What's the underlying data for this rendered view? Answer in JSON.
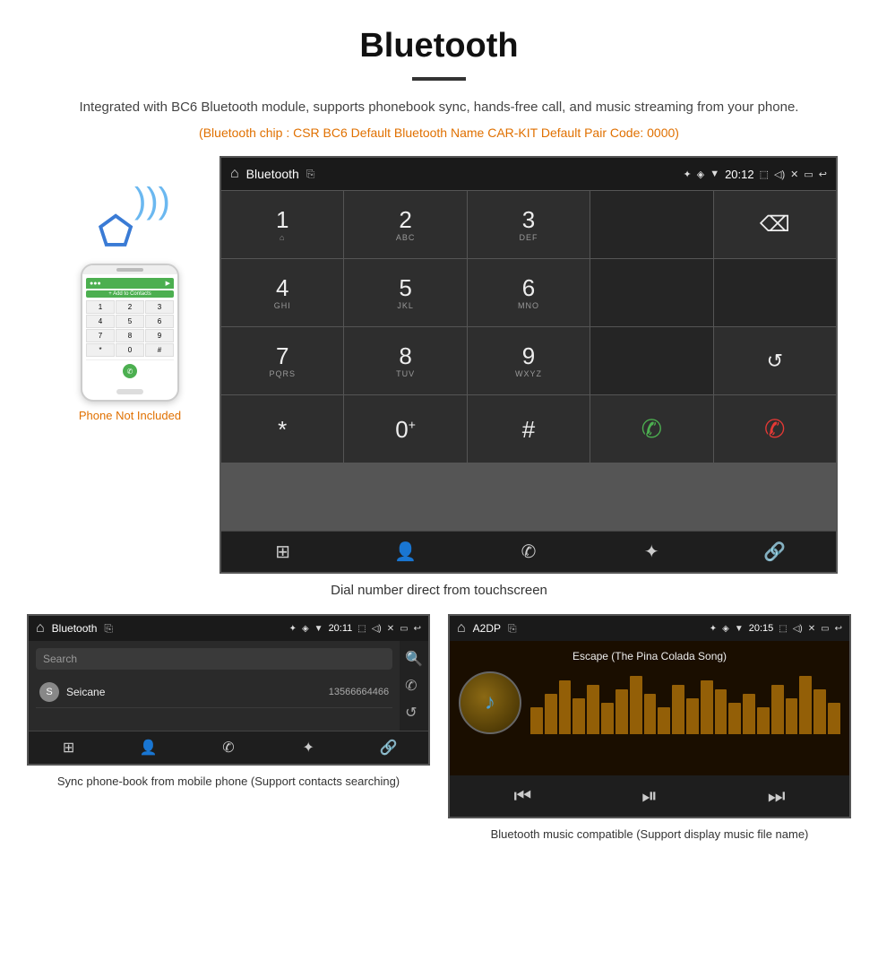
{
  "page": {
    "title": "Bluetooth",
    "subtitle": "Integrated with BC6 Bluetooth module, supports phonebook sync, hands-free call, and music streaming from your phone.",
    "orange_info": "(Bluetooth chip : CSR BC6    Default Bluetooth Name CAR-KIT    Default Pair Code: 0000)",
    "phone_not_included": "Phone Not Included",
    "caption_dial": "Dial number direct from touchscreen",
    "caption_phonebook": "Sync phone-book from mobile phone\n(Support contacts searching)",
    "caption_music": "Bluetooth music compatible\n(Support display music file name)"
  },
  "car_screen_main": {
    "status_bar": {
      "title": "Bluetooth",
      "time": "20:12"
    },
    "dialpad": [
      {
        "num": "1",
        "sub": "⌂",
        "type": "key"
      },
      {
        "num": "2",
        "sub": "ABC",
        "type": "key"
      },
      {
        "num": "3",
        "sub": "DEF",
        "type": "key"
      },
      {
        "num": "",
        "sub": "",
        "type": "empty"
      },
      {
        "num": "⌫",
        "sub": "",
        "type": "backspace"
      },
      {
        "num": "4",
        "sub": "GHI",
        "type": "key"
      },
      {
        "num": "5",
        "sub": "JKL",
        "type": "key"
      },
      {
        "num": "6",
        "sub": "MNO",
        "type": "key"
      },
      {
        "num": "",
        "sub": "",
        "type": "empty"
      },
      {
        "num": "",
        "sub": "",
        "type": "empty"
      },
      {
        "num": "7",
        "sub": "PQRS",
        "type": "key"
      },
      {
        "num": "8",
        "sub": "TUV",
        "type": "key"
      },
      {
        "num": "9",
        "sub": "WXYZ",
        "type": "key"
      },
      {
        "num": "",
        "sub": "",
        "type": "empty"
      },
      {
        "num": "↺",
        "sub": "",
        "type": "refresh"
      },
      {
        "num": "*",
        "sub": "",
        "type": "key"
      },
      {
        "num": "0",
        "sub": "+",
        "type": "key0"
      },
      {
        "num": "#",
        "sub": "",
        "type": "key"
      },
      {
        "num": "📞",
        "sub": "",
        "type": "call-green"
      },
      {
        "num": "📞",
        "sub": "",
        "type": "call-red"
      }
    ],
    "bottom_nav": [
      "⊞",
      "👤",
      "📞",
      "✦",
      "🔗"
    ]
  },
  "phonebook_screen": {
    "status_bar": {
      "title": "Bluetooth",
      "time": "20:11"
    },
    "search_placeholder": "Search",
    "contacts": [
      {
        "letter": "S",
        "name": "Seicane",
        "number": "13566664466"
      }
    ],
    "side_icons": [
      "🔍",
      "📞",
      "↺"
    ],
    "bottom_nav": [
      "⊞",
      "👤",
      "📞",
      "✦",
      "🔗"
    ]
  },
  "music_screen": {
    "status_bar": {
      "title": "A2DP",
      "time": "20:15"
    },
    "song_title": "Escape (The Pina Colada Song)",
    "viz_bars": [
      30,
      45,
      60,
      40,
      55,
      35,
      50,
      65,
      45,
      30,
      55,
      40,
      60,
      50,
      35,
      45,
      30,
      55,
      40,
      65,
      50,
      35
    ],
    "controls": [
      "⏮",
      "⏯",
      "⏭"
    ]
  }
}
